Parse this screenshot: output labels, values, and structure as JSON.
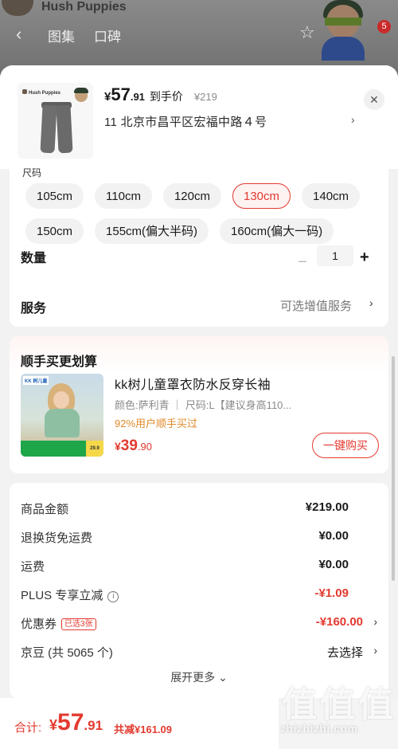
{
  "background": {
    "brand": "Hush Puppies",
    "tabs": [
      "图集",
      "口碑"
    ],
    "notification_count": "5"
  },
  "header": {
    "price_symbol": "¥",
    "price_int": "57",
    "price_dec": ".91",
    "price_label": "到手价",
    "original_price": "¥219",
    "address": "11  北京市昌平区宏福中路４号",
    "thumb_brand": "Hush Puppies"
  },
  "specs": {
    "cut_label": "尺码",
    "sizes": [
      "105cm",
      "110cm",
      "120cm",
      "130cm",
      "140cm",
      "150cm",
      "155cm(偏大半码)",
      "160cm(偏大一码)"
    ],
    "selected_size": "130cm",
    "quantity_label": "数量",
    "quantity_minus": "−",
    "quantity": "1",
    "quantity_plus": "+",
    "service_label": "服务",
    "service_value": "可选增值服务"
  },
  "recommend": {
    "title": "顺手买更划算",
    "image_tag": "KK 树儿童",
    "image_badge": "29.9",
    "name": "kk树儿童罩衣防水反穿长袖",
    "spec": "颜色:萨利青 ｜ 尺码:L【建议身高110...",
    "rate": "92%用户顺手买过",
    "price_symbol": "¥",
    "price_int": "39",
    "price_dec": ".90",
    "buy_label": "一键购买"
  },
  "costs": {
    "rows": [
      {
        "label": "商品金额",
        "value": "¥219.00"
      },
      {
        "label": "退换货免运费",
        "value": "¥0.00"
      },
      {
        "label": "运费",
        "value": "¥0.00"
      },
      {
        "label": "PLUS 专享立减",
        "value": "-¥1.09"
      },
      {
        "label": "优惠券",
        "value": "-¥160.00",
        "badge": "已选3张"
      },
      {
        "label": "京豆 (共 5065 个)",
        "value": "去选择"
      }
    ],
    "expand_label": "展开更多"
  },
  "bottom": {
    "total_label": "合计:",
    "total_symbol": "¥",
    "total_int": "57",
    "total_dec": ".91",
    "saved": "共减¥161.09",
    "watermark": "zhizhizhi.com",
    "watermark_glyph": "值"
  },
  "colors": {
    "accent": "#e33a2f",
    "rate_orange": "#e08a2a"
  }
}
